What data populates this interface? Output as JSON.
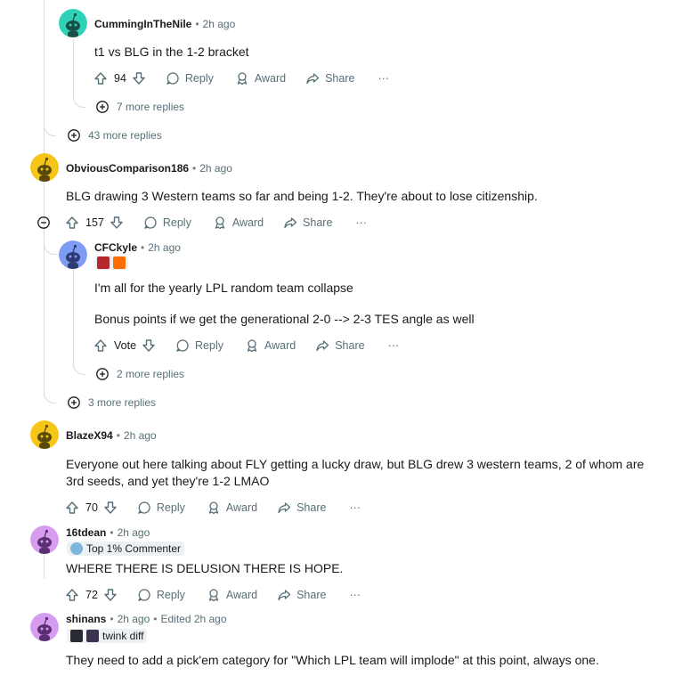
{
  "comments": {
    "c1": {
      "username": "CummingInTheNile",
      "time": "2h ago",
      "body": "t1 vs BLG in the 1-2 bracket",
      "votes": "94",
      "more_replies": "7 more replies"
    },
    "c1_parent_more": "43 more replies",
    "c2": {
      "username": "ObviousComparison186",
      "time": "2h ago",
      "body": "BLG drawing 3 Western teams so far and being 1-2. They're about to lose citizenship.",
      "votes": "157"
    },
    "c3": {
      "username": "CFCkyle",
      "time": "2h ago",
      "body_line1": "I'm all for the yearly LPL random team collapse",
      "body_line2": "Bonus points if we get the generational 2-0 --> 2-3 TES angle as well",
      "votes": "Vote",
      "more_replies": "2 more replies"
    },
    "c2_more": "3 more replies",
    "c4": {
      "username": "BlazeX94",
      "time": "2h ago",
      "body_line1": "Everyone out here talking about FLY getting a lucky draw, but BLG drew 3 western teams, 2 of whom are",
      "body_line2": "3rd seeds, and yet they're 1-2 LMAO",
      "votes": "70"
    },
    "c5": {
      "username": "16tdean",
      "time": "2h ago",
      "flair": "Top 1% Commenter",
      "body": "WHERE THERE IS DELUSION THERE IS HOPE.",
      "votes": "72"
    },
    "c6": {
      "username": "shinans",
      "time": "2h ago",
      "edited": "Edited 2h ago",
      "flair": "twink diff",
      "body": "They need to add a pick'em category for \"Which LPL team will implode\" at this point, always one."
    }
  },
  "labels": {
    "reply": "Reply",
    "award": "Award",
    "share": "Share",
    "ellipsis": "···"
  },
  "colors": {
    "teal": "#2ed3b7",
    "yellow": "#f5c518",
    "blue": "#7f9cf5",
    "purple": "#d59cf0",
    "line": "#dadcde",
    "meta": "#576f76"
  },
  "icons": [
    "snoo-avatar-icon",
    "upvote-icon",
    "downvote-icon",
    "comment-icon",
    "award-icon",
    "share-icon",
    "plus-circle-icon",
    "minus-circle-icon"
  ]
}
